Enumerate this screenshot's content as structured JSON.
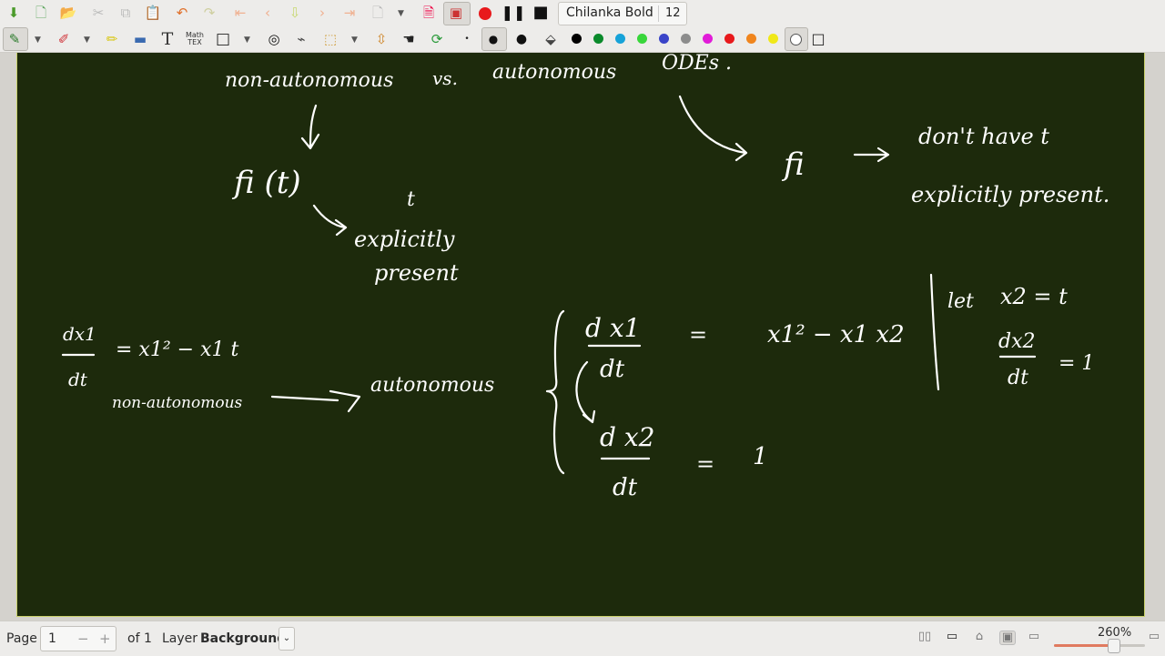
{
  "toolbar": {
    "font_name": "Chilanka Bold",
    "font_size": "12",
    "math_tex_label": "Math\nTEX",
    "record_color": "#e8191c",
    "colors": [
      "#000000",
      "#0a8a2b",
      "#16a2d8",
      "#38d63a",
      "#3a44c8",
      "#8c8c8c",
      "#e11cd8",
      "#e8191c",
      "#f0851d",
      "#f0e818",
      "#ffffff"
    ]
  },
  "canvas": {
    "background": "#1d2a0c",
    "border_color": "#c8d06a",
    "notes": {
      "top_left_heading": "non-autonomous",
      "vs": "vs.",
      "top_autonomous": "autonomous",
      "odes": "ODEs .",
      "fi_t": "fi (t)",
      "t_small": "t",
      "explicitly": "explicitly",
      "present": "present",
      "fi_right": "fi",
      "dont_have_t": "don't have t",
      "explicitly_present": "explicitly present.",
      "eq1_num": "dx1",
      "eq1_den": "dt",
      "eq1_rhs": "= x1² − x1 t",
      "non_autonomous": "non-autonomous",
      "autonomous": "autonomous",
      "sys_dx1": "d x1",
      "sys_dt1": "dt",
      "sys_eq1": "=",
      "sys_rhs1": "x1² − x1 x2",
      "sys_dx2": "d x2",
      "sys_dt2": "dt",
      "sys_eq2": "=",
      "sys_rhs2": "1",
      "let": "let",
      "let_expr": "x2 = t",
      "let_num": "dx2",
      "let_den": "dt",
      "let_rhs": "= 1"
    }
  },
  "status": {
    "page_label": "Page",
    "page_value": "1",
    "minus": "−",
    "plus": "+",
    "of": "of 1",
    "layer_label": "Layer",
    "layer_value": "Background",
    "zoom": "260%",
    "zoom_fraction": 0.65
  }
}
